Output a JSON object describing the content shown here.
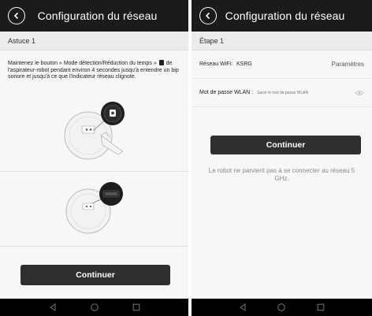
{
  "left_screen": {
    "title": "Configuration du réseau",
    "subheader": "Astuce 1",
    "instruction_part1": "Maintenez le bouton « Mode détection/Réduction du temps »",
    "instruction_part2": "de l'aspirateur-robot pendant environ 4 secondes jusqu'à entendre un bip sonore et jusqu'à ce que l'indicateur réseau clignote.",
    "continue_label": "Continuer"
  },
  "right_screen": {
    "title": "Configuration du réseau",
    "subheader": "Étape 1",
    "wifi_label": "Réseau WiFi:",
    "wifi_value": "KSRG",
    "settings_link": "Paramètres",
    "password_label": "Mot de passe WLAN :",
    "password_placeholder": "Saisir le mot de passe WLAN",
    "continue_label": "Continuer",
    "note": "Le robot ne parvient pas à se connecter au réseau 5 GHz."
  },
  "icons": {
    "back": "back-arrow-circle-icon",
    "eye": "eye-icon",
    "nav_back": "triangle-back-icon",
    "nav_home": "circle-home-icon",
    "nav_recent": "square-recent-icon"
  },
  "colors": {
    "appbar": "#1b1b1b",
    "button": "#2f2f2f",
    "background": "#f7f7f7",
    "note_text": "#8a8a8a"
  }
}
